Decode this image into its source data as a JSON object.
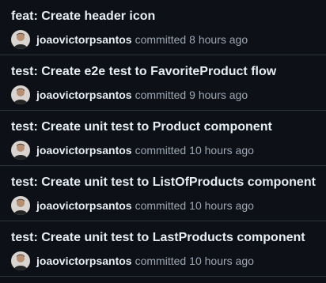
{
  "commits": [
    {
      "title": "feat: Create header icon",
      "author": "joaovictorpsantos",
      "action": "committed",
      "time": "8 hours ago"
    },
    {
      "title": "test: Create e2e test to FavoriteProduct flow",
      "author": "joaovictorpsantos",
      "action": "committed",
      "time": "9 hours ago"
    },
    {
      "title": "test: Create unit test to Product component",
      "author": "joaovictorpsantos",
      "action": "committed",
      "time": "10 hours ago"
    },
    {
      "title": "test: Create unit test to ListOfProducts component",
      "author": "joaovictorpsantos",
      "action": "committed",
      "time": "10 hours ago"
    },
    {
      "title": "test: Create unit test to LastProducts component",
      "author": "joaovictorpsantos",
      "action": "committed",
      "time": "10 hours ago"
    }
  ],
  "colors": {
    "background": "#0d1117",
    "border": "#30363d",
    "text_primary": "#e6edf3",
    "text_muted": "#9da7b3"
  },
  "icons": {
    "avatar": "user-avatar-icon"
  }
}
